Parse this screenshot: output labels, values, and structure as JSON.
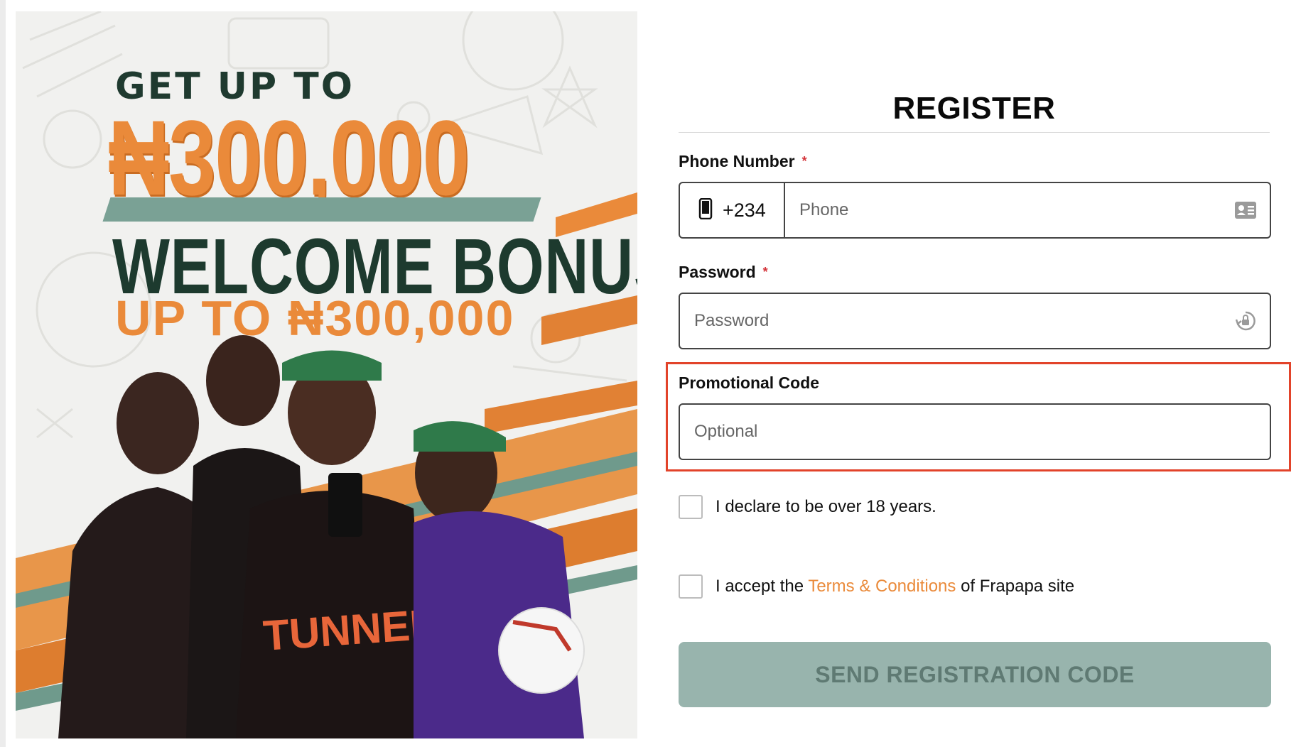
{
  "banner": {
    "headline_top": "GET UP TO",
    "headline_amount": "₦300,000",
    "headline_welcome": "WELCOME BONUS",
    "headline_sub": "UP TO ₦300,000",
    "colors": {
      "accent_orange": "#ea8a3a",
      "dark_green": "#1d3a2e",
      "sage": "#7aa195"
    }
  },
  "register": {
    "title": "REGISTER",
    "phone": {
      "label": "Phone Number",
      "required_mark": "*",
      "country_code": "+234",
      "placeholder": "Phone",
      "prefix_icon": "mobile-phone-icon",
      "suffix_icon": "contact-card-icon"
    },
    "password": {
      "label": "Password",
      "required_mark": "*",
      "placeholder": "Password",
      "suffix_icon": "lock-refresh-icon"
    },
    "promo": {
      "label": "Promotional Code",
      "placeholder": "Optional"
    },
    "age_declaration": {
      "checked": false,
      "text": "I declare to be over 18 years."
    },
    "terms": {
      "checked": false,
      "text_before": "I accept the",
      "link_text": "Terms & Conditions",
      "text_after": "of Frapapa site"
    },
    "submit_label": "SEND REGISTRATION CODE",
    "colors": {
      "highlight_frame": "#e2432a",
      "button_bg": "#98b4ad",
      "link": "#ea8a3a",
      "required": "#d4343a"
    }
  }
}
